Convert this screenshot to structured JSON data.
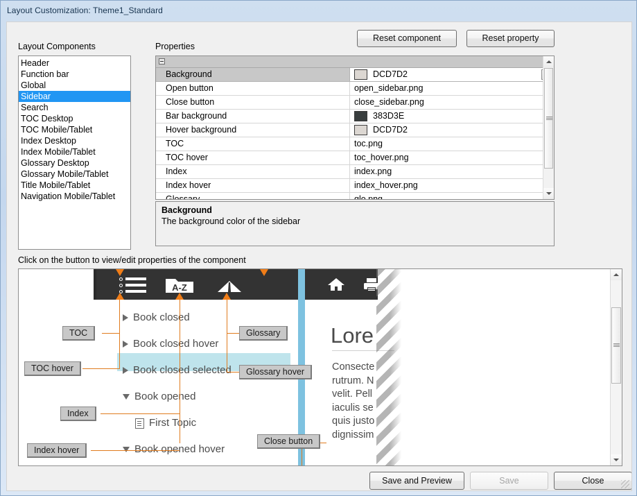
{
  "window": {
    "title": "Layout Customization: Theme1_Standard"
  },
  "sections": {
    "layout_components_label": "Layout Components",
    "properties_label": "Properties",
    "preview_hint": "Click on the button to view/edit properties of the component"
  },
  "toolbar": {
    "reset_component": "Reset component",
    "reset_property": "Reset property"
  },
  "layout_components": {
    "selected": "Sidebar",
    "items": [
      "Header",
      "Function bar",
      "Global",
      "Sidebar",
      "Search",
      "TOC Desktop",
      "TOC Mobile/Tablet",
      "Index Desktop",
      "Index Mobile/Tablet",
      "Glossary Desktop",
      "Glossary Mobile/Tablet",
      "Title Mobile/Tablet",
      "Navigation Mobile/Tablet"
    ]
  },
  "properties": {
    "rows": [
      {
        "name": "Background",
        "value": "DCD7D2",
        "swatch": "#DCD7D2",
        "selected": true,
        "combo": true
      },
      {
        "name": "Open button",
        "value": "open_sidebar.png",
        "swatch": null,
        "selected": false,
        "combo": false
      },
      {
        "name": "Close button",
        "value": "close_sidebar.png",
        "swatch": null,
        "selected": false,
        "combo": false
      },
      {
        "name": "Bar background",
        "value": "383D3E",
        "swatch": "#383D3E",
        "selected": false,
        "combo": false
      },
      {
        "name": "Hover background",
        "value": "DCD7D2",
        "swatch": "#DCD7D2",
        "selected": false,
        "combo": false
      },
      {
        "name": "TOC",
        "value": "toc.png",
        "swatch": null,
        "selected": false,
        "combo": false
      },
      {
        "name": "TOC hover",
        "value": "toc_hover.png",
        "swatch": null,
        "selected": false,
        "combo": false
      },
      {
        "name": "Index",
        "value": "index.png",
        "swatch": null,
        "selected": false,
        "combo": false
      },
      {
        "name": "Index hover",
        "value": "index_hover.png",
        "swatch": null,
        "selected": false,
        "combo": false
      },
      {
        "name": "Glossary",
        "value": "glo.png",
        "swatch": null,
        "selected": false,
        "combo": false
      }
    ]
  },
  "description": {
    "title": "Background",
    "text": "The background color of the sidebar"
  },
  "preview": {
    "title": "Lore",
    "body": "Consecte\nrutrum. N\nvelit. Pell\niaculis se\nquis justo\ndignissim",
    "tree": [
      {
        "label": "Book closed",
        "icon": "triangle-right"
      },
      {
        "label": "Book closed hover",
        "icon": "triangle-right"
      },
      {
        "label": "Book closed selected",
        "icon": "triangle-right"
      },
      {
        "label": "Book opened",
        "icon": "triangle-down"
      },
      {
        "label": "First Topic",
        "icon": "document"
      },
      {
        "label": "Book opened hover",
        "icon": "triangle-down"
      }
    ],
    "callouts": [
      "TOC",
      "TOC hover",
      "Index",
      "Index hover",
      "Glossary",
      "Glossary hover",
      "Close button"
    ],
    "icons": [
      "toc-list-icon",
      "index-az-folder-icon",
      "glossary-book-icon",
      "home-icon",
      "print-icon"
    ],
    "colors": {
      "bar_background": "#333333",
      "accent_blue": "#7ec2e0",
      "selection": "#bfe4ec",
      "callout_line": "#e07b1e"
    }
  },
  "footer": {
    "save_and_preview": "Save and Preview",
    "save": "Save",
    "close": "Close",
    "save_disabled": true
  }
}
